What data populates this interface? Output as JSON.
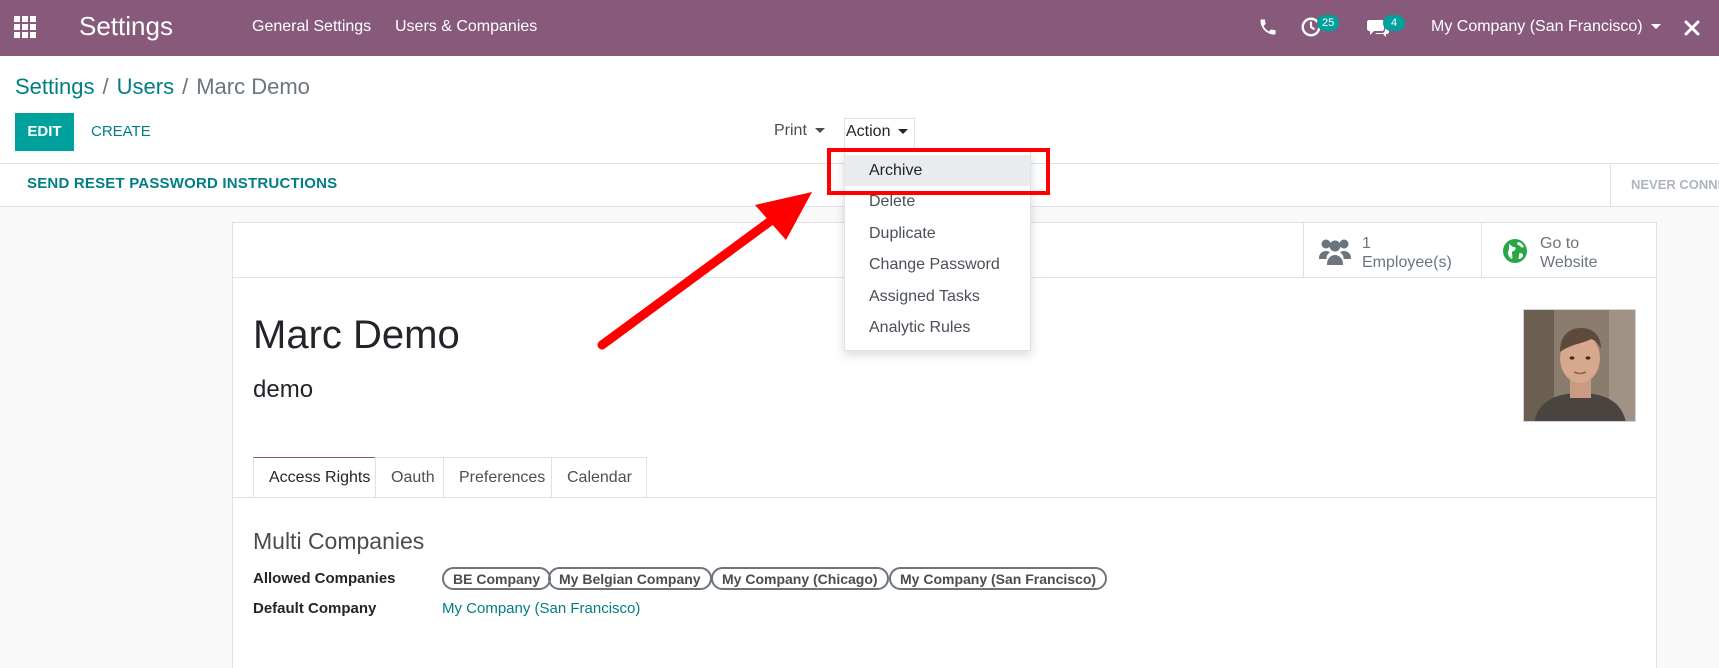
{
  "topbar": {
    "app_title": "Settings",
    "nav": [
      "General Settings",
      "Users & Companies"
    ],
    "activity_badge": "25",
    "messages_badge": "4",
    "company_switcher": "My Company (San Francisco)",
    "icons": [
      "apps-icon",
      "phone-icon",
      "clock-icon",
      "chat-icon",
      "close-icon"
    ],
    "bg_color": "#875a7b"
  },
  "breadcrumb": {
    "items": [
      "Settings",
      "Users"
    ],
    "current": "Marc Demo"
  },
  "buttons": {
    "edit": "EDIT",
    "create": "CREATE",
    "print": "Print",
    "action": "Action"
  },
  "statusbar": {
    "reset_password": "SEND RESET PASSWORD INSTRUCTIONS",
    "never_connected": "NEVER CONNECTED"
  },
  "action_menu": {
    "items": [
      "Archive",
      "Delete",
      "Duplicate",
      "Change Password",
      "Assigned Tasks",
      "Analytic Rules"
    ],
    "active_item": "Archive"
  },
  "smart_buttons": {
    "employees_count": "1",
    "employees_label": "Employee(s)",
    "website_line1": "Go to",
    "website_line2": "Website"
  },
  "user": {
    "name": "Marc Demo",
    "login": "demo"
  },
  "tabs": [
    "Access Rights",
    "Oauth",
    "Preferences",
    "Calendar"
  ],
  "active_tab": "Access Rights",
  "access_rights": {
    "section_title": "Multi Companies",
    "allowed_label": "Allowed Companies",
    "allowed_companies": [
      "BE Company",
      "My Belgian Company",
      "My Company (Chicago)",
      "My Company (San Francisco)"
    ],
    "default_label": "Default Company",
    "default_company": "My Company (San Francisco)"
  },
  "colors": {
    "brand": "#875a7b",
    "primary": "#00a09d",
    "link": "#017e84",
    "annotation": "#ff0000"
  }
}
